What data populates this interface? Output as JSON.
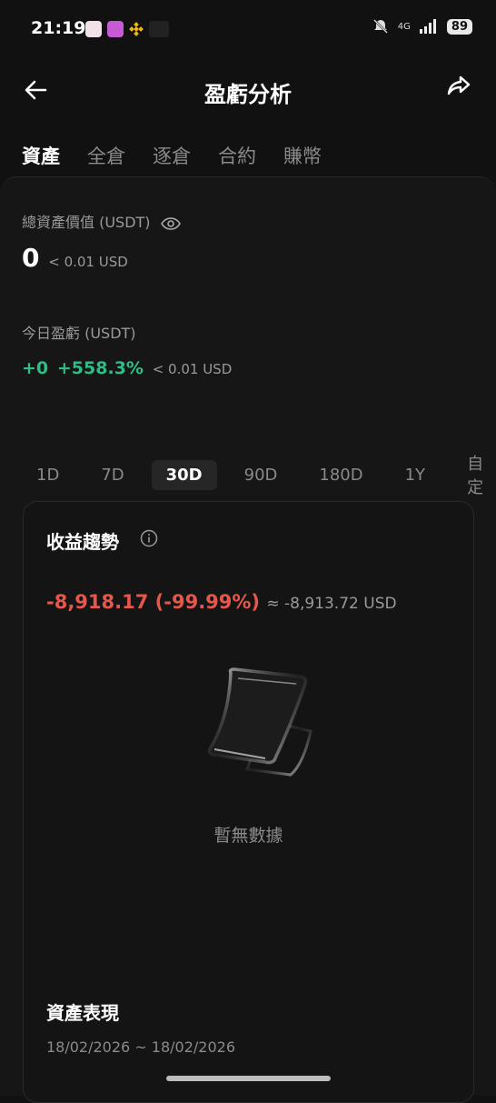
{
  "status_bar": {
    "time": "21:19",
    "network": "4G",
    "battery": "89"
  },
  "header": {
    "title": "盈虧分析"
  },
  "tabs": [
    {
      "label": "資產"
    },
    {
      "label": "全倉"
    },
    {
      "label": "逐倉"
    },
    {
      "label": "合約"
    },
    {
      "label": "賺幣"
    }
  ],
  "total_assets": {
    "label": "總資產價值 (USDT)",
    "value": "0",
    "usd": "< 0.01 USD"
  },
  "today_pnl": {
    "label": "今日盈虧 (USDT)",
    "value": "+0",
    "percent": "+558.3%",
    "usd": "< 0.01 USD"
  },
  "periods": [
    {
      "label": "1D"
    },
    {
      "label": "7D"
    },
    {
      "label": "30D"
    },
    {
      "label": "90D"
    },
    {
      "label": "180D"
    },
    {
      "label": "1Y"
    },
    {
      "label": "自定"
    }
  ],
  "trend_card": {
    "title": "收益趨勢",
    "pnl_value": "-8,918.17",
    "pnl_percent": "(-99.99%)",
    "pnl_usd": "≈ -8,913.72 USD",
    "empty_text": "暫無數據"
  },
  "performance": {
    "title": "資產表現",
    "date_range": "18/02/2026 ~ 18/02/2026"
  },
  "colors": {
    "positive": "#2ebd85",
    "negative": "#e5574a",
    "background": "#111111"
  }
}
